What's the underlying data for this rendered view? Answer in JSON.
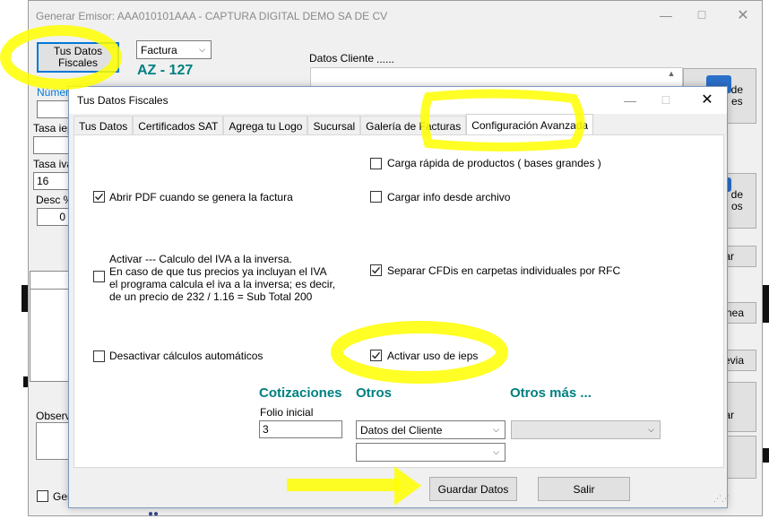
{
  "main_window": {
    "title": "Generar    Emisor: AAA010101AAA  -  CAPTURA DIGITAL DEMO SA DE CV",
    "tus_datos_button": "Tus Datos Fiscales",
    "document_type": "Factura",
    "folio": "AZ - 127",
    "datos_cliente_label": "Datos Cliente",
    "datos_cliente_dots": "......",
    "numero_label": "Número",
    "tasa_ieps_label": "Tasa iep",
    "tasa_iva_label": "Tasa iva",
    "tasa_iva_value": "16",
    "desc_label": "Desc %",
    "desc_value": "0",
    "observa_label": "Observa",
    "gen_checkbox_label": "Gen",
    "side_btn_1": "de\nes",
    "side_btn_2": "de\nos",
    "side_btn_3": "ar",
    "side_btn_4": "nea",
    "side_btn_5": "evia",
    "side_btn_6": "ar"
  },
  "dialog": {
    "title": "Tus Datos Fiscales",
    "tabs": [
      {
        "label": "Tus Datos"
      },
      {
        "label": "Certificados SAT"
      },
      {
        "label": "Agrega tu Logo"
      },
      {
        "label": "Sucursal"
      },
      {
        "label": "Galería de Facturas"
      },
      {
        "label": "Configuración Avanzada"
      }
    ],
    "options": {
      "carga_rapida": {
        "label": "Carga rápida de productos ( bases grandes )",
        "checked": false
      },
      "abrir_pdf": {
        "label": "Abrir PDF cuando se genera la factura",
        "checked": true
      },
      "cargar_info": {
        "label": "Cargar info desde archivo",
        "checked": false
      },
      "iva_inversa": {
        "label_lines": [
          "Activar --- Calculo del IVA a la inversa.",
          "En caso de que tus precios ya incluyan el IVA",
          "el programa calcula el iva a la inversa; es decir,",
          "de un precio de 232 / 1.16 = Sub Total 200"
        ],
        "checked": false
      },
      "separar_cfdis": {
        "label": "Separar CFDis en carpetas individuales por RFC",
        "checked": true
      },
      "desactivar_calculos": {
        "label": "Desactivar cálculos automáticos",
        "checked": false
      },
      "activar_ieps": {
        "label": "Activar uso de ieps",
        "checked": true
      }
    },
    "cotizaciones_heading": "Cotizaciones",
    "otros_heading": "Otros",
    "otros_mas_heading": "Otros más ...",
    "folio_inicial_label": "Folio inicial",
    "folio_inicial_value": "3",
    "otros_select_1": "Datos del Cliente",
    "otros_select_2": "",
    "otros_mas_select": "",
    "guardar_button": "Guardar Datos",
    "salir_button": "Salir"
  },
  "colors": {
    "teal_heading": "#008080",
    "highlight": "#ffff00",
    "focus_blue": "#0078d7"
  }
}
